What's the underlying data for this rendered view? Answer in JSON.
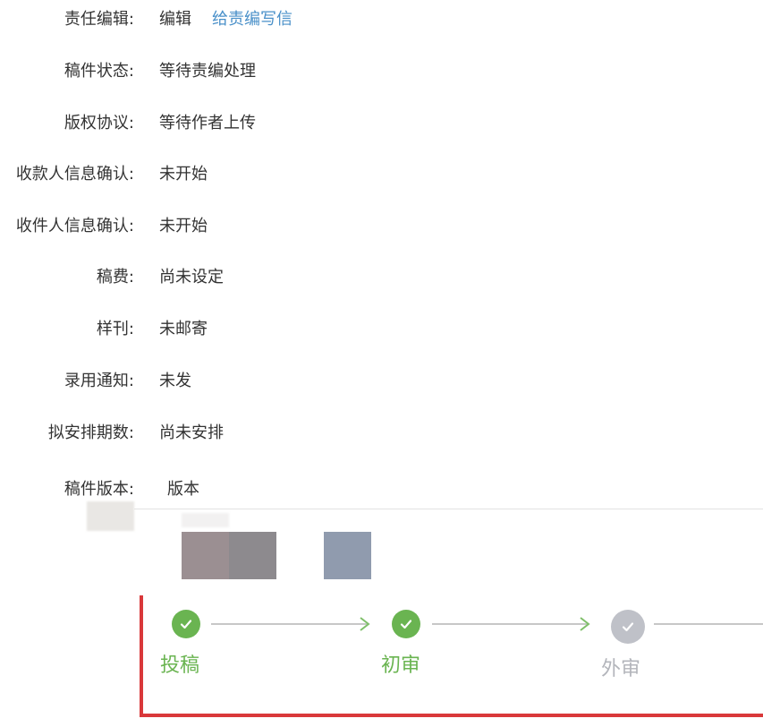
{
  "fields": [
    {
      "label": "责任编辑:",
      "value": "编辑",
      "link": "给责编写信"
    },
    {
      "label": "稿件状态:",
      "value": "等待责编处理"
    },
    {
      "label": "版权协议:",
      "value": "等待作者上传"
    },
    {
      "label": "收款人信息确认:",
      "value": "未开始"
    },
    {
      "label": "收件人信息确认:",
      "value": "未开始"
    },
    {
      "label": "稿费:",
      "value": "尚未设定"
    },
    {
      "label": "样刊:",
      "value": "未邮寄"
    },
    {
      "label": "录用通知:",
      "value": "未发"
    },
    {
      "label": "拟安排期数:",
      "value": "尚未安排"
    }
  ],
  "version": {
    "label": "稿件版本:",
    "value": "版本"
  },
  "progress": {
    "steps": [
      {
        "label": "投稿",
        "status": "done"
      },
      {
        "label": "初审",
        "status": "done"
      },
      {
        "label": "外审",
        "status": "pending"
      }
    ]
  },
  "colors": {
    "done": "#6ab451",
    "pending": "#bfc1c8",
    "link": "#4a90c9",
    "highlight": "#d9383a"
  },
  "icons": {
    "done": "check-circle-icon",
    "pending": "check-circle-icon",
    "connector": "arrow-right-icon"
  }
}
